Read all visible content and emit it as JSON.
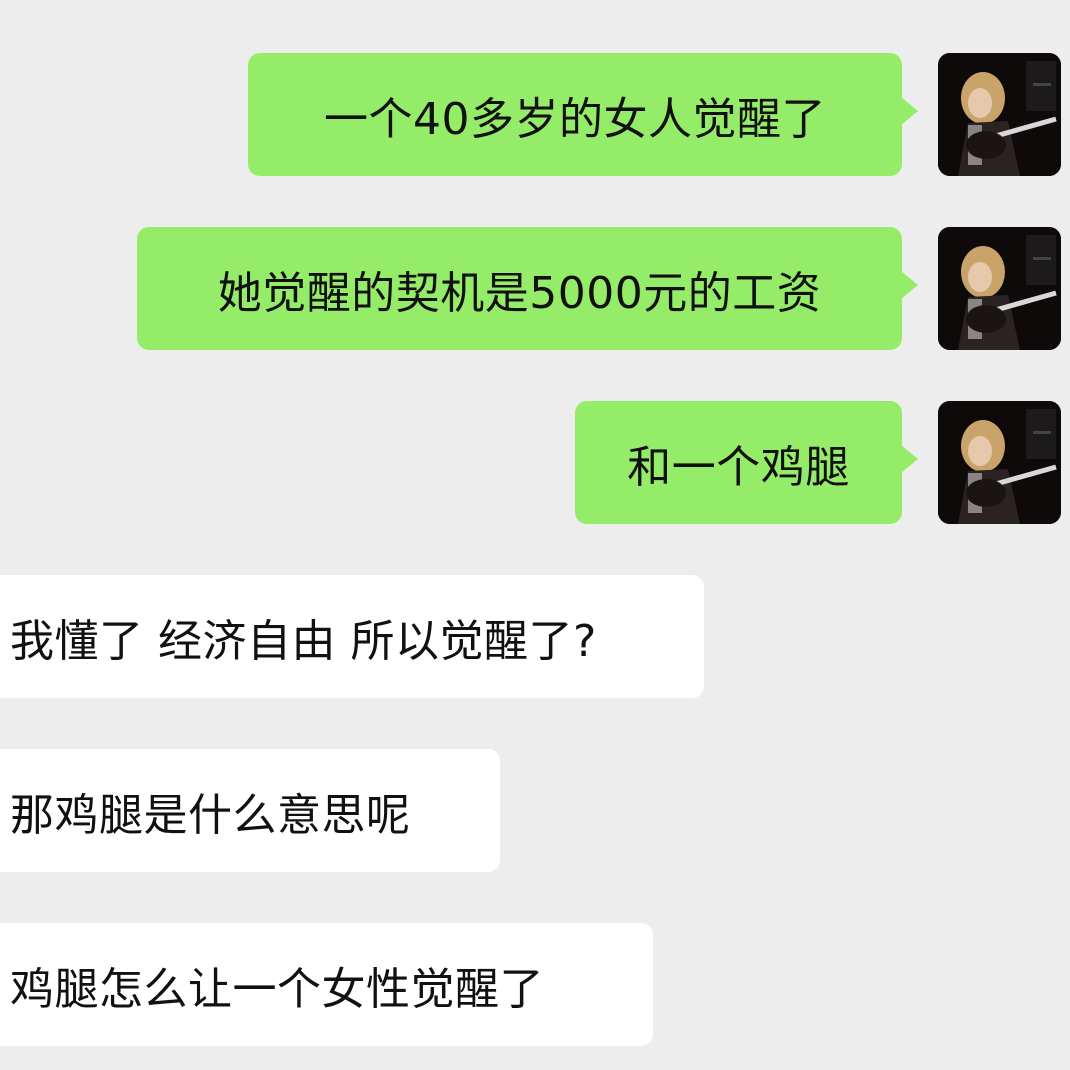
{
  "conversation": {
    "messages": [
      {
        "side": "sent",
        "text": "一个40多岁的女人觉醒了"
      },
      {
        "side": "sent",
        "text": "她觉醒的契机是5000元的工资"
      },
      {
        "side": "sent",
        "text": "和一个鸡腿"
      },
      {
        "side": "received",
        "text": "我懂了 经济自由 所以觉醒了?"
      },
      {
        "side": "received",
        "text": "那鸡腿是什么意思呢"
      },
      {
        "side": "received",
        "text": "鸡腿怎么让一个女性觉醒了"
      }
    ]
  },
  "colors": {
    "background": "#ededed",
    "sent_bubble": "#95ec69",
    "received_bubble": "#ffffff",
    "text": "#111111"
  },
  "icons": {
    "avatar": "user-avatar-photo"
  }
}
